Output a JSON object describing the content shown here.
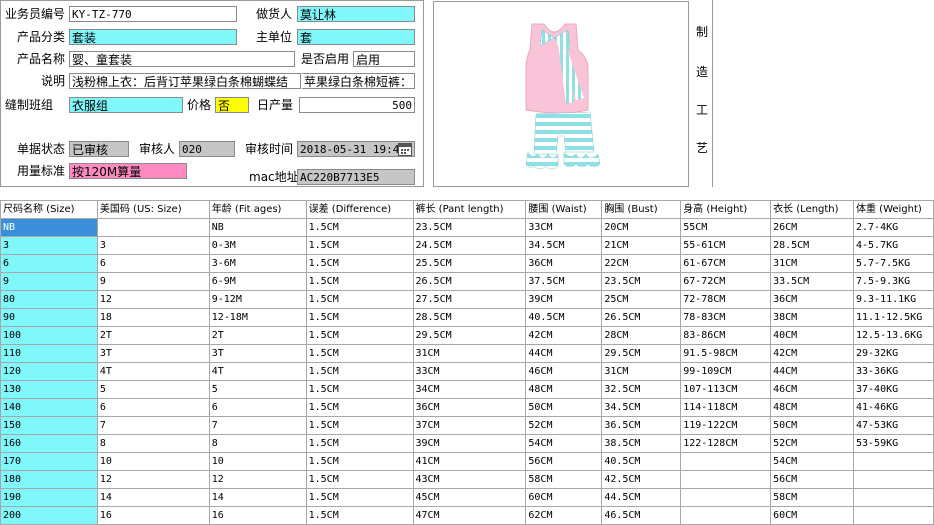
{
  "form": {
    "salesperson_no_label": "业务员编号",
    "salesperson_no": "KY-TZ-770",
    "maker_label": "做货人",
    "maker": "莫让林",
    "category_label": "产品分类",
    "category": "套装",
    "unit_label": "主单位",
    "unit": "套",
    "product_name_label": "产品名称",
    "product_name": "婴、童套装",
    "enabled_label": "是否启用",
    "enabled": "启用",
    "desc_label": "说明",
    "desc1": "浅粉棉上衣：后背订苹果绿白条棉蝴蝶结",
    "desc2": "苹果绿白条棉短裤：",
    "team_label": "缝制班组",
    "team": "衣服组",
    "price_label": "价格",
    "price": "否",
    "daily_label": "日产量",
    "daily": "500",
    "status_label": "单据状态",
    "status": "已审核",
    "auditor_label": "审核人",
    "auditor": "020",
    "audit_time_label": "审核时间",
    "audit_time": "2018-05-31  19:4",
    "material_label": "用量标准",
    "material": "按120M算量",
    "mac_label": "mac地址",
    "mac": "AC220B7713E5"
  },
  "side_text": [
    "制",
    "造",
    "工",
    "艺"
  ],
  "product_image": {
    "top_color": "#f9c4d8",
    "stripe_color": "#8ee0e4"
  },
  "table": {
    "headers": [
      "尺码名称 (Size)",
      "美国码 (US: Size)",
      "年龄 (Fit ages)",
      "误差 (Difference)",
      "裤长 (Pant length)",
      "腰围 (Waist)",
      "胸围 (Bust)",
      "身高 (Height)",
      "衣长 (Length)",
      "体重 (Weight)"
    ],
    "rows": [
      [
        "NB",
        "",
        "NB",
        "1.5CM",
        "23.5CM",
        "33CM",
        "20CM",
        "55CM",
        "26CM",
        "2.7-4KG"
      ],
      [
        "3",
        "3",
        "0-3M",
        "1.5CM",
        "24.5CM",
        "34.5CM",
        "21CM",
        "55-61CM",
        "28.5CM",
        "4-5.7KG"
      ],
      [
        "6",
        "6",
        "3-6M",
        "1.5CM",
        "25.5CM",
        "36CM",
        "22CM",
        "61-67CM",
        "31CM",
        "5.7-7.5KG"
      ],
      [
        "9",
        "9",
        "6-9M",
        "1.5CM",
        "26.5CM",
        "37.5CM",
        "23.5CM",
        "67-72CM",
        "33.5CM",
        "7.5-9.3KG"
      ],
      [
        "80",
        "12",
        "9-12M",
        "1.5CM",
        "27.5CM",
        "39CM",
        "25CM",
        "72-78CM",
        "36CM",
        "9.3-11.1KG"
      ],
      [
        "90",
        "18",
        "12-18M",
        "1.5CM",
        "28.5CM",
        "40.5CM",
        "26.5CM",
        "78-83CM",
        "38CM",
        "11.1-12.5KG"
      ],
      [
        "100",
        "2T",
        "2T",
        "1.5CM",
        "29.5CM",
        "42CM",
        "28CM",
        "83-86CM",
        "40CM",
        "12.5-13.6KG"
      ],
      [
        "110",
        "3T",
        "3T",
        "1.5CM",
        "31CM",
        "44CM",
        "29.5CM",
        "91.5-98CM",
        "42CM",
        "29-32KG"
      ],
      [
        "120",
        "4T",
        "4T",
        "1.5CM",
        "33CM",
        "46CM",
        "31CM",
        "99-109CM",
        "44CM",
        "33-36KG"
      ],
      [
        "130",
        "5",
        "5",
        "1.5CM",
        "34CM",
        "48CM",
        "32.5CM",
        "107-113CM",
        "46CM",
        "37-40KG"
      ],
      [
        "140",
        "6",
        "6",
        "1.5CM",
        "36CM",
        "50CM",
        "34.5CM",
        "114-118CM",
        "48CM",
        "41-46KG"
      ],
      [
        "150",
        "7",
        "7",
        "1.5CM",
        "37CM",
        "52CM",
        "36.5CM",
        "119-122CM",
        "50CM",
        "47-53KG"
      ],
      [
        "160",
        "8",
        "8",
        "1.5CM",
        "39CM",
        "54CM",
        "38.5CM",
        "122-128CM",
        "52CM",
        "53-59KG"
      ],
      [
        "170",
        "10",
        "10",
        "1.5CM",
        "41CM",
        "56CM",
        "40.5CM",
        "",
        "54CM",
        ""
      ],
      [
        "180",
        "12",
        "12",
        "1.5CM",
        "43CM",
        "58CM",
        "42.5CM",
        "",
        "56CM",
        ""
      ],
      [
        "190",
        "14",
        "14",
        "1.5CM",
        "45CM",
        "60CM",
        "44.5CM",
        "",
        "58CM",
        ""
      ],
      [
        "200",
        "16",
        "16",
        "1.5CM",
        "47CM",
        "62CM",
        "46.5CM",
        "",
        "60CM",
        ""
      ]
    ]
  }
}
